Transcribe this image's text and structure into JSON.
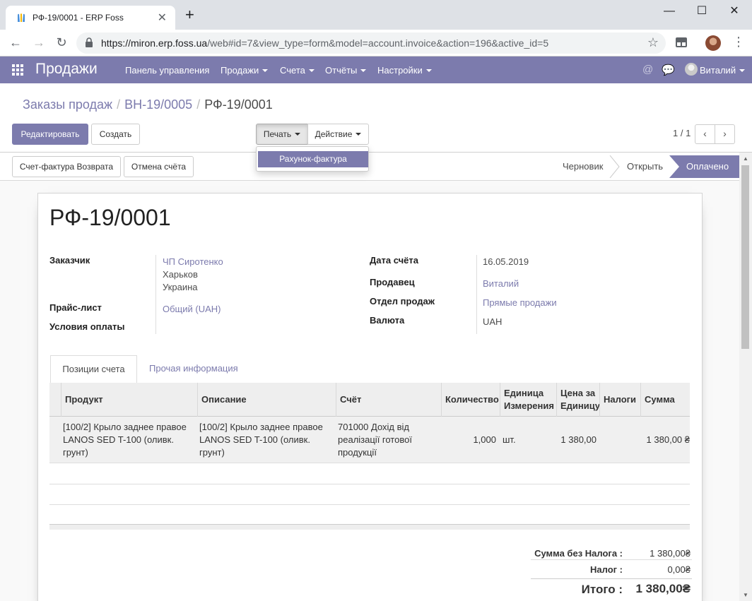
{
  "browser": {
    "tab_title": "РФ-19/0001 - ERP Foss",
    "url_host": "https://miron.erp.foss.ua",
    "url_path": "/web#id=7&view_type=form&model=account.invoice&action=196&active_id=5",
    "new_tab_icon": "plus-icon",
    "minimize_icon": "minimize-icon",
    "maximize_icon": "maximize-icon",
    "close_icon": "close-icon"
  },
  "app_nav": {
    "brand": "Продажи",
    "menus": [
      "Панель управления",
      "Продажи",
      "Счета",
      "Отчёты",
      "Настройки"
    ],
    "user": "Виталий",
    "accent_color": "#7c7bad"
  },
  "breadcrumb": {
    "items": [
      "Заказы продаж",
      "ВН-19/0005"
    ],
    "current": "РФ-19/0001"
  },
  "buttons": {
    "edit": "Редактировать",
    "create": "Создать",
    "print": "Печать",
    "action": "Действие",
    "refund": "Счет-фактура Возврата",
    "cancel": "Отмена счёта"
  },
  "print_menu": {
    "items": [
      "Рахунок-фактура"
    ]
  },
  "pager": {
    "value": "1 / 1"
  },
  "statusbar": {
    "stages": [
      "Черновик",
      "Открыть",
      "Оплачено"
    ],
    "active": "Оплачено"
  },
  "invoice": {
    "number": "РФ-19/0001",
    "customer_label": "Заказчик",
    "customer_name": "ЧП Сиротенко",
    "customer_city": "Харьков",
    "customer_country": "Украина",
    "pricelist_label": "Прайс-лист",
    "pricelist": "Общий (UAH)",
    "payment_terms_label": "Условия оплаты",
    "date_label": "Дата счёта",
    "date": "16.05.2019",
    "salesperson_label": "Продавец",
    "salesperson": "Виталий",
    "team_label": "Отдел продаж",
    "team": "Прямые продажи",
    "currency_label": "Валюта",
    "currency": "UAH"
  },
  "tabs": {
    "lines": "Позиции счета",
    "other": "Прочая информация"
  },
  "lines_table": {
    "headers": {
      "product": "Продукт",
      "description": "Описание",
      "account": "Счёт",
      "quantity": "Количество",
      "uom": "Единица Измерения",
      "unit_price": "Цена за Единицу",
      "taxes": "Налоги",
      "amount": "Сумма"
    },
    "rows": [
      {
        "product": "[100/2] Крыло заднее правое LANOS SED T-100 (оливк. грунт)",
        "description": "[100/2] Крыло заднее правое LANOS SED T-100 (оливк. грунт)",
        "account": "701000 Дохід від реалізації готової продукції",
        "quantity": "1,000",
        "uom": "шт.",
        "unit_price": "1 380,00",
        "taxes": "",
        "amount": "1 380,00 ₴"
      }
    ]
  },
  "totals": {
    "untaxed_label": "Сумма без Налога :",
    "untaxed": "1 380,00₴",
    "tax_label": "Налог :",
    "tax": "0,00₴",
    "total_label": "Итого :",
    "total": "1 380,00₴"
  }
}
